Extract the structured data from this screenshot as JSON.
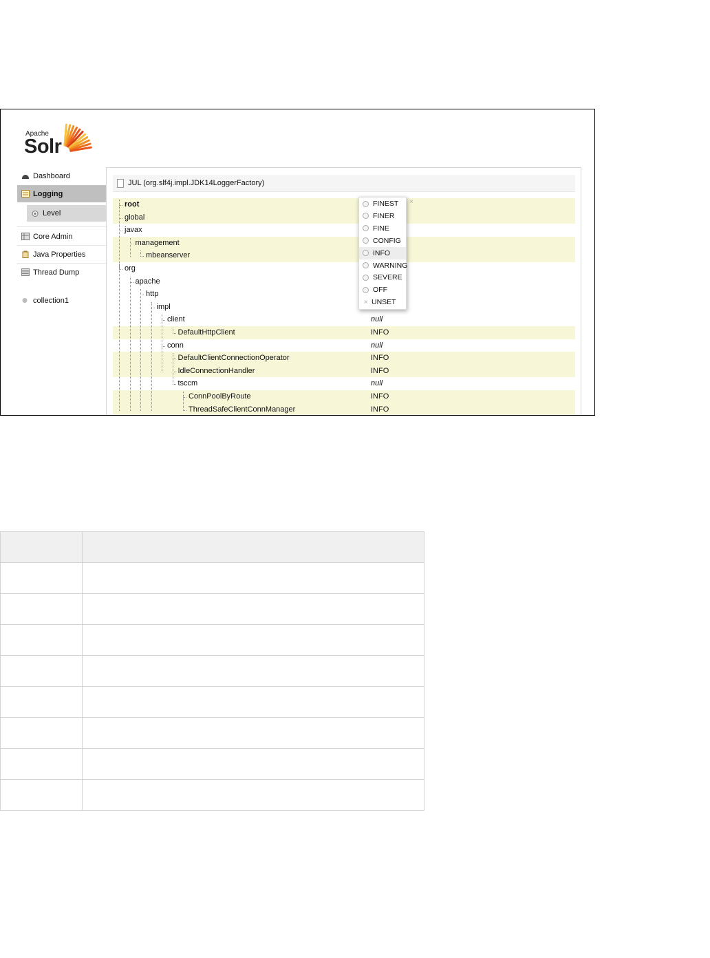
{
  "logo": {
    "apache": "Apache",
    "solr": "Solr"
  },
  "sidebar": {
    "items": [
      {
        "label": "Dashboard",
        "icon": "dashboard-icon"
      },
      {
        "label": "Logging",
        "icon": "logging-icon",
        "active": true
      },
      {
        "label": "Level",
        "icon": "gear-icon",
        "sub": true
      },
      {
        "label": "Core Admin",
        "icon": "core-admin-icon"
      },
      {
        "label": "Java Properties",
        "icon": "java-properties-icon"
      },
      {
        "label": "Thread Dump",
        "icon": "thread-dump-icon"
      },
      {
        "label": "collection1",
        "icon": "collection-dot-icon"
      }
    ]
  },
  "panel": {
    "title": "JUL (org.slf4j.impl.JDK14LoggerFactory)",
    "rows": [
      {
        "name": "root",
        "level": ""
      },
      {
        "name": "global",
        "level": ""
      },
      {
        "name": "javax",
        "level": ""
      },
      {
        "name": "management",
        "level": ""
      },
      {
        "name": "mbeanserver",
        "level": ""
      },
      {
        "name": "org",
        "level": ""
      },
      {
        "name": "apache",
        "level": ""
      },
      {
        "name": "http",
        "level": ""
      },
      {
        "name": "impl",
        "level": ""
      },
      {
        "name": "client",
        "level": "null"
      },
      {
        "name": "DefaultHttpClient",
        "level": "INFO"
      },
      {
        "name": "conn",
        "level": "null"
      },
      {
        "name": "DefaultClientConnectionOperator",
        "level": "INFO"
      },
      {
        "name": "IdleConnectionHandler",
        "level": "INFO"
      },
      {
        "name": "tsccm",
        "level": "null"
      },
      {
        "name": "ConnPoolByRoute",
        "level": "INFO"
      },
      {
        "name": "ThreadSafeClientConnManager",
        "level": "INFO"
      }
    ]
  },
  "dropdown": {
    "options": [
      "FINEST",
      "FINER",
      "FINE",
      "CONFIG",
      "INFO",
      "WARNING",
      "SEVERE",
      "OFF",
      "UNSET"
    ],
    "selected": "INFO",
    "close": "×",
    "unset_mark": "×"
  },
  "table": {
    "header": [
      "",
      ""
    ],
    "rows": [
      [
        "",
        ""
      ],
      [
        "",
        ""
      ],
      [
        "",
        ""
      ],
      [
        "",
        ""
      ],
      [
        "",
        ""
      ],
      [
        "",
        ""
      ],
      [
        "",
        ""
      ],
      [
        "",
        ""
      ]
    ]
  },
  "colors": {
    "highlight": "#f7f7d8",
    "active_nav": "#bfbfbf",
    "sub_nav": "#d8d8d8"
  }
}
